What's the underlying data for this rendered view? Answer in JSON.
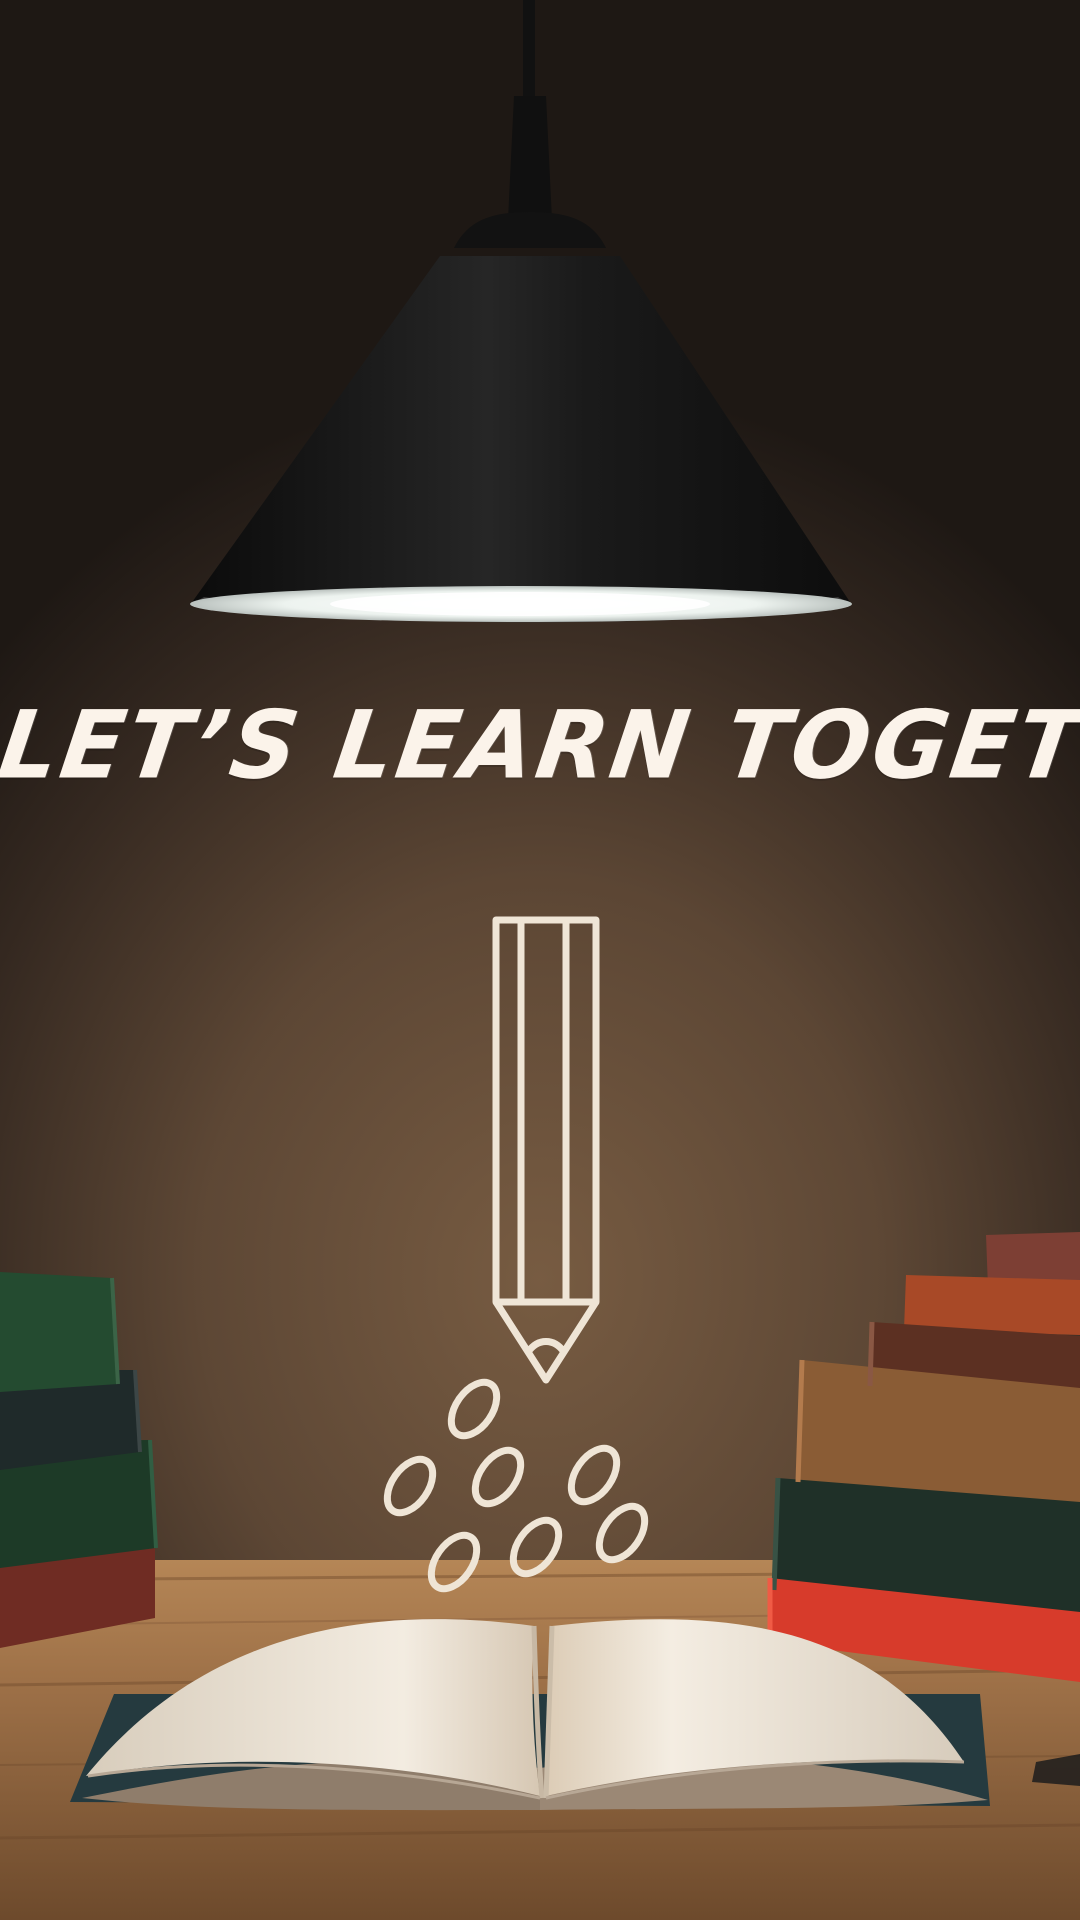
{
  "headline": "LET’S LEARN TOGETHER",
  "colors": {
    "background_top": "#241c17",
    "background_mid": "#6a543f",
    "lamp_shade": "#171717",
    "lamp_light": "#f4f7f4",
    "headline": "#fbf3ea",
    "chalk_outline": "#efe5d6",
    "table_wood": "#a77a4d",
    "book_pages": "#eee4d4"
  },
  "icons": [
    "pendant-lamp-icon",
    "pencil-icon",
    "seed-icon",
    "open-book-icon",
    "book-stack-icon"
  ]
}
